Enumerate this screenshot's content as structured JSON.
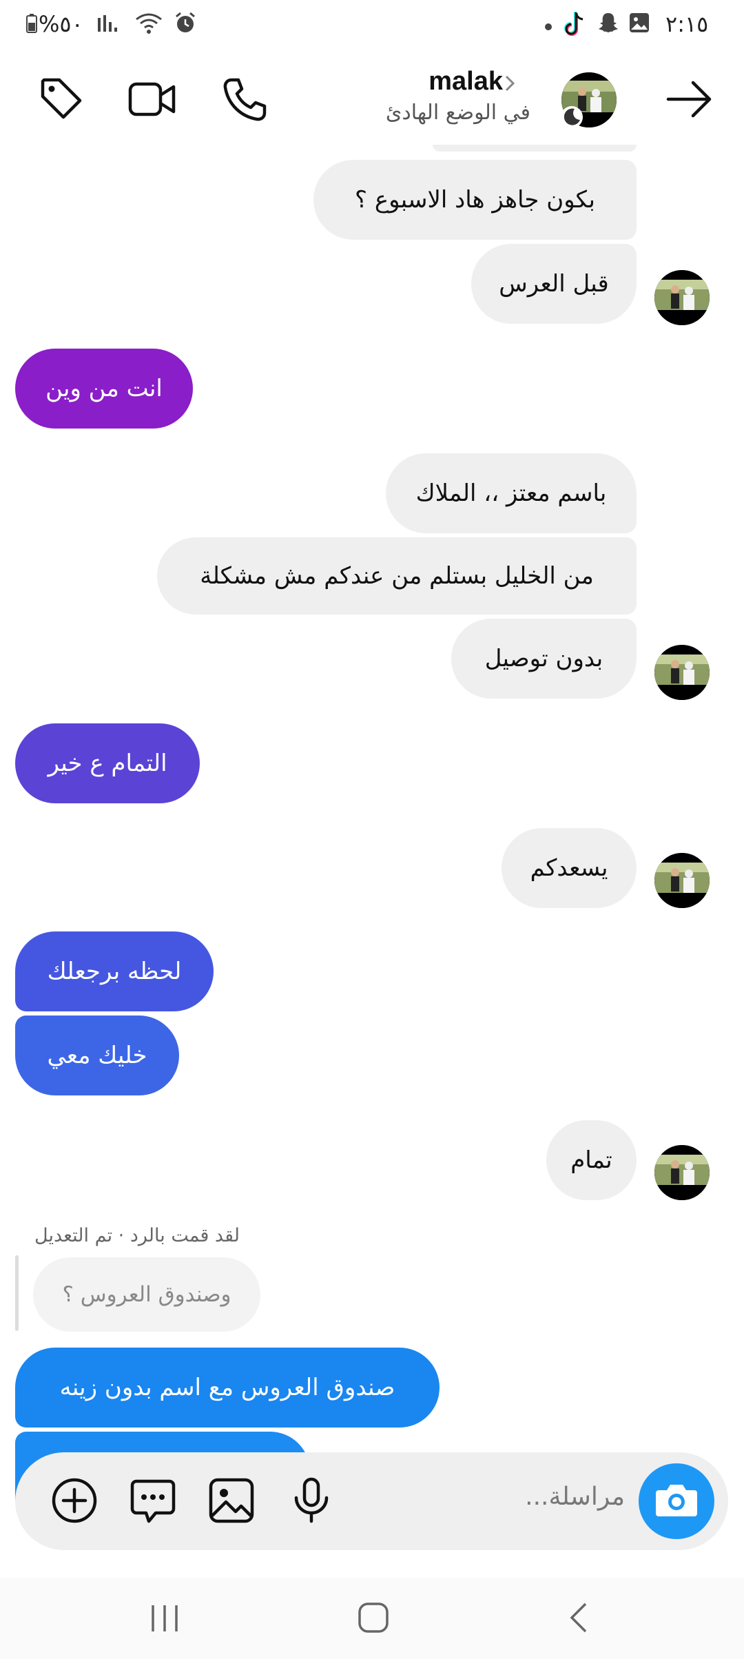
{
  "status_bar": {
    "time": "٢:١٥",
    "battery": "%٥٠",
    "notification_icons": [
      "dot-icon",
      "tiktok-icon",
      "snapchat-icon",
      "gallery-icon"
    ],
    "system_icons": [
      "battery-icon",
      "signal-icon",
      "wifi-icon",
      "alarm-icon"
    ]
  },
  "header": {
    "contact_name": "malak",
    "contact_status": "في الوضع الهادئ",
    "icons": [
      "back-arrow-icon",
      "phone-icon",
      "video-call-icon",
      "tag-icon",
      "chevron-right-icon"
    ]
  },
  "messages": [
    {
      "side": "incoming",
      "text": "بكون جاهز هاد الاسبوع ؟"
    },
    {
      "side": "incoming",
      "text": "قبل العرس"
    },
    {
      "side": "outgoing",
      "text": "انت من وين",
      "color": "#8a1ec8"
    },
    {
      "side": "incoming",
      "text": "باسم معتز ،، الملاك"
    },
    {
      "side": "incoming",
      "text": "من الخليل بستلم من عندكم مش مشكلة"
    },
    {
      "side": "incoming",
      "text": "بدون توصيل"
    },
    {
      "side": "outgoing",
      "text": "التمام ع خير",
      "color": "#5b43d6"
    },
    {
      "side": "incoming",
      "text": "يسعدكم"
    },
    {
      "side": "outgoing",
      "text": "لحظه برجعلك",
      "color": "#4557e0"
    },
    {
      "side": "outgoing",
      "text": "خليك معي",
      "color": "#3d66e6"
    },
    {
      "side": "incoming",
      "text": "تمام"
    }
  ],
  "reply": {
    "note": "لقد قمت بالرد · تم التعديل",
    "quoted": "وصندوق العروس ؟",
    "message": "صندوق العروس مع اسم بدون زينه",
    "color": "#1a86f0",
    "next_color": "#1d8cf2"
  },
  "composer": {
    "placeholder": "مراسلة...",
    "icons": [
      "camera-icon",
      "microphone-icon",
      "gallery-icon",
      "sticker-icon",
      "add-icon"
    ]
  },
  "nav_bar": {
    "icons": [
      "recent-apps-icon",
      "home-icon",
      "back-icon"
    ]
  }
}
